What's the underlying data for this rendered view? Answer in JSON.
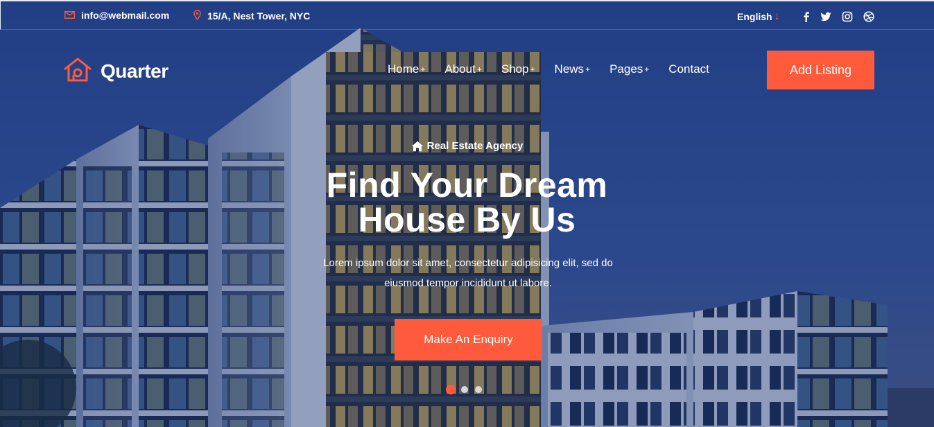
{
  "topbar": {
    "email": "info@webmail.com",
    "address": "15/A, Nest Tower, NYC",
    "language": "English",
    "social_icons": [
      "facebook-icon",
      "twitter-icon",
      "instagram-icon",
      "dribbble-icon"
    ]
  },
  "brand": {
    "name": "Quarter",
    "logo_icon": "house-icon"
  },
  "nav": {
    "items": [
      {
        "label": "Home",
        "has_submenu": true
      },
      {
        "label": "About",
        "has_submenu": true
      },
      {
        "label": "Shop",
        "has_submenu": true
      },
      {
        "label": "News",
        "has_submenu": true
      },
      {
        "label": "Pages",
        "has_submenu": true
      },
      {
        "label": "Contact",
        "has_submenu": false
      }
    ],
    "submenu_marker": "+",
    "cta_label": "Add Listing"
  },
  "hero": {
    "tagline": "Real Estate Agency",
    "headline_line1": "Find Your Dream",
    "headline_line2": "House By Us",
    "description": "Lorem ipsum dolor sit amet, consectetur adipisicing elit, sed do eiusmod tempor incididunt ut labore.",
    "cta_label": "Make An Enquiry",
    "slides_total": 3,
    "slide_active": 1
  },
  "colors": {
    "accent": "#ff5a3c",
    "overlay": "#1d2f63",
    "text": "#ffffff"
  }
}
